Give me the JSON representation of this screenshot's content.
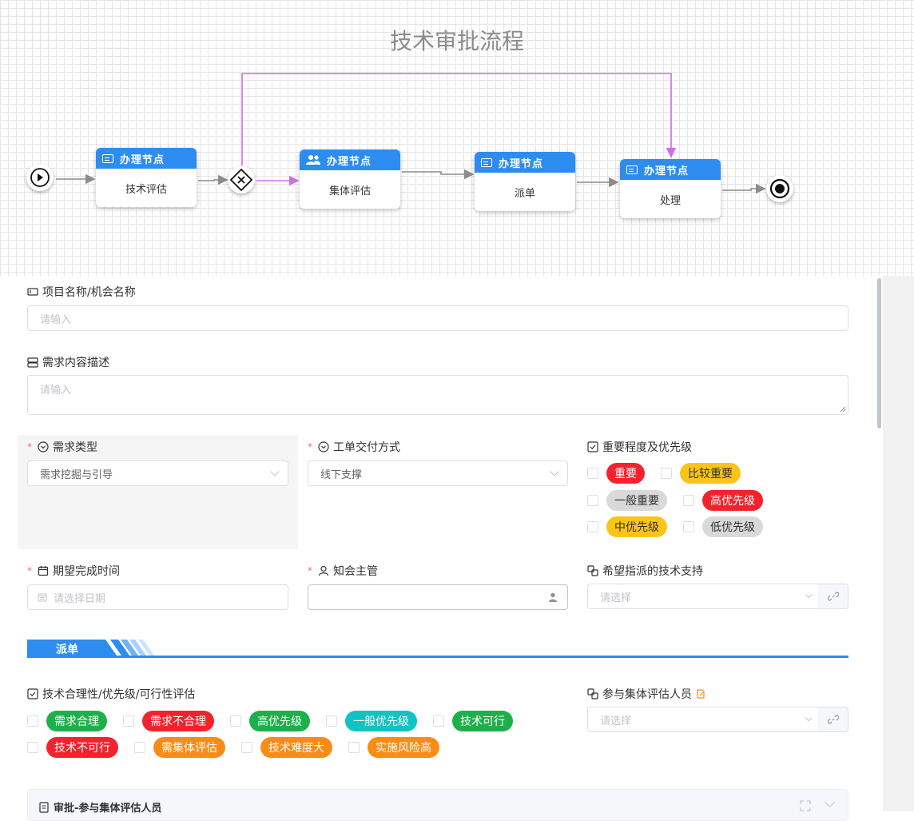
{
  "flow": {
    "title": "技术审批流程",
    "nodes": [
      {
        "head": "办理节点",
        "body": "技术评估"
      },
      {
        "head": "办理节点",
        "body": "集体评估"
      },
      {
        "head": "办理节点",
        "body": "派单"
      },
      {
        "head": "办理节点",
        "body": "处理"
      }
    ]
  },
  "form": {
    "project_name": {
      "label": "项目名称/机会名称",
      "placeholder": "请输入"
    },
    "demand_desc": {
      "label": "需求内容描述",
      "placeholder": "请输入"
    },
    "demand_type": {
      "label": "需求类型",
      "value": "需求挖掘与引导"
    },
    "delivery": {
      "label": "工单交付方式",
      "value": "线下支撑"
    },
    "priority": {
      "label": "重要程度及优先级",
      "options": [
        {
          "text": "重要",
          "bg": "#f5222d",
          "fg": "#ffffff"
        },
        {
          "text": "比较重要",
          "bg": "#fcc419",
          "fg": "#303133"
        },
        {
          "text": "一般重要",
          "bg": "#d9d9d9",
          "fg": "#303133"
        },
        {
          "text": "高优先级",
          "bg": "#f5222d",
          "fg": "#ffffff"
        },
        {
          "text": "中优先级",
          "bg": "#fcc419",
          "fg": "#303133"
        },
        {
          "text": "低优先级",
          "bg": "#d9d9d9",
          "fg": "#303133"
        }
      ]
    },
    "due_date": {
      "label": "期望完成时间",
      "placeholder": "请选择日期"
    },
    "manager": {
      "label": "知会主管"
    },
    "tech_support": {
      "label": "希望指派的技术支持",
      "placeholder": "请选择"
    },
    "section": {
      "title": "派单"
    },
    "evaluation": {
      "label": "技术合理性/优先级/可行性评估",
      "options": [
        {
          "text": "需求合理",
          "bg": "#1db04a",
          "fg": "#ffffff"
        },
        {
          "text": "需求不合理",
          "bg": "#f5222d",
          "fg": "#ffffff"
        },
        {
          "text": "高优先级",
          "bg": "#1db04a",
          "fg": "#ffffff"
        },
        {
          "text": "一般优先级",
          "bg": "#13c2c2",
          "fg": "#ffffff"
        },
        {
          "text": "技术可行",
          "bg": "#1db04a",
          "fg": "#ffffff"
        },
        {
          "text": "技术不可行",
          "bg": "#f5222d",
          "fg": "#ffffff"
        },
        {
          "text": "需集体评估",
          "bg": "#fa8c16",
          "fg": "#ffffff"
        },
        {
          "text": "技术难度大",
          "bg": "#fa8c16",
          "fg": "#ffffff"
        },
        {
          "text": "实施风险高",
          "bg": "#fa8c16",
          "fg": "#ffffff"
        }
      ]
    },
    "participants": {
      "label": "参与集体评估人员",
      "placeholder": "请选择"
    },
    "approval_panel": {
      "title": "审批-参与集体评估人员"
    }
  },
  "colors": {
    "primary": "#2d8cf0",
    "flow_edge": "#d070e0"
  }
}
